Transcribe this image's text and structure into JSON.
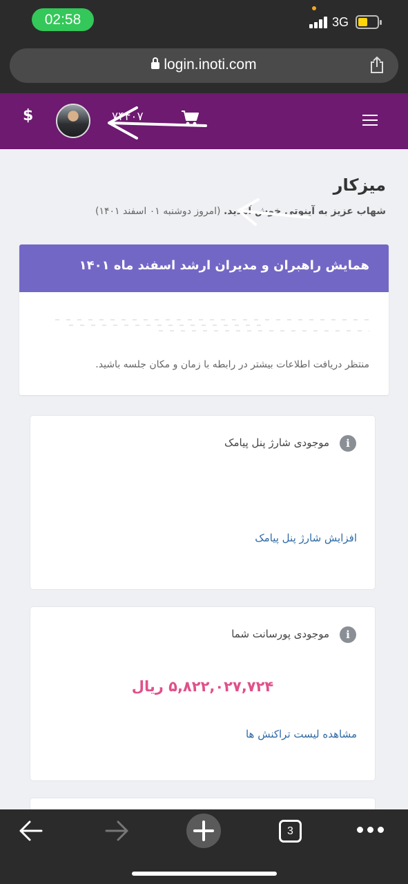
{
  "status_bar": {
    "time": "02:58",
    "network": "3G"
  },
  "browser": {
    "url": "login.inoti.com",
    "tab_count": "3"
  },
  "header": {
    "cart_count": "۷۴۴۰۷",
    "currency_symbol": "$"
  },
  "page": {
    "title": "میزکار",
    "welcome_name": "شهاب عزیز به آینوتی خوش آمدید.",
    "welcome_date": "(امروز دوشنبه ۰۱ اسفند ۱۴۰۱)"
  },
  "event_card": {
    "title": "همایش راهبران و مدیران ارشد اسفند ماه ۱۴۰۱",
    "body": "منتظر دریافت اطلاعات بیشتر در رابطه با زمان و مکان جلسه باشید."
  },
  "sms_card": {
    "title": "موجودی شارژ پنل پیامک",
    "link": "افزایش شارژ پنل پیامک"
  },
  "commission_card": {
    "title": "موجودی پورسانت شما",
    "amount": "۵,۸۲۲,۰۲۷,۷۲۴ ریال",
    "link": "مشاهده لیست تراکنش ها"
  },
  "icons": [
    "lock-icon",
    "share-icon",
    "menu-icon",
    "cart-icon",
    "avatar",
    "info-icon",
    "back-icon",
    "forward-icon",
    "plus-icon",
    "tabs-icon",
    "more-icon"
  ],
  "colors": {
    "header": "#6d1a70",
    "event_header": "#7367c6",
    "amount": "#e0508a",
    "link": "#2e6aa6"
  }
}
